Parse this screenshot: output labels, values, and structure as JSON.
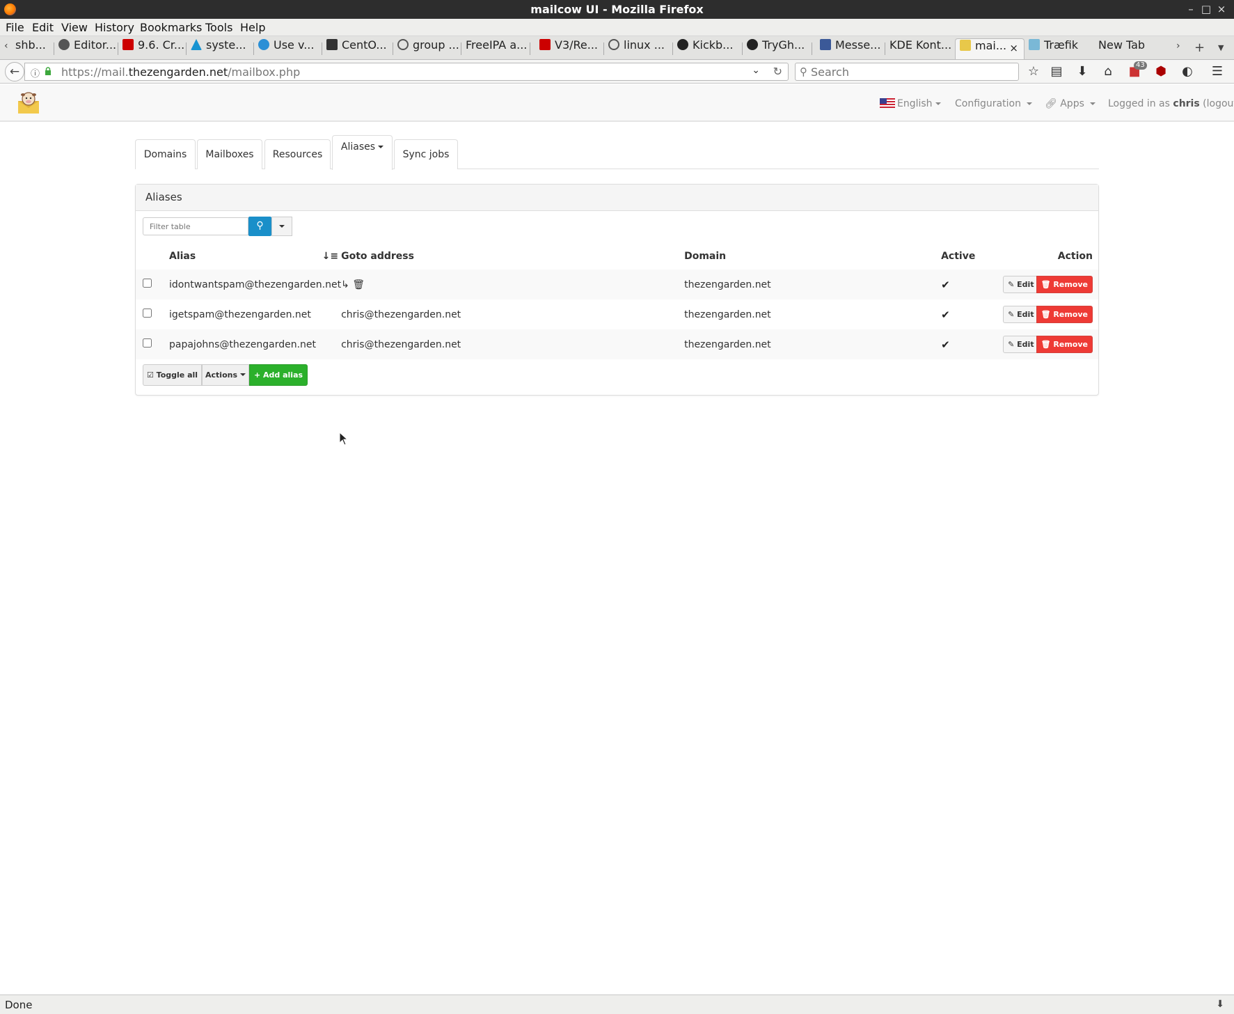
{
  "window": {
    "title": "mailcow UI - Mozilla Firefox",
    "minimize": "–",
    "maximize": "□",
    "close": "×"
  },
  "menu": [
    "File",
    "Edit",
    "View",
    "History",
    "Bookmarks",
    "Tools",
    "Help"
  ],
  "tabs": [
    {
      "label": "shb...",
      "icon": "page-icon"
    },
    {
      "label": "Editor...",
      "icon": "g-icon"
    },
    {
      "label": "9.6. Cr...",
      "icon": "redhat-icon"
    },
    {
      "label": "syste...",
      "icon": "arch-icon"
    },
    {
      "label": "Use v...",
      "icon": "globe-icon"
    },
    {
      "label": "CentO...",
      "icon": "book-icon"
    },
    {
      "label": "group ...",
      "icon": "google-icon"
    },
    {
      "label": "FreeIPA a...",
      "icon": "none"
    },
    {
      "label": "V3/Re...",
      "icon": "redhat-icon"
    },
    {
      "label": "linux ...",
      "icon": "google-icon"
    },
    {
      "label": "Kickb...",
      "icon": "github-icon"
    },
    {
      "label": "TryGh...",
      "icon": "github-icon"
    },
    {
      "label": "Messe...",
      "icon": "facebook-icon"
    },
    {
      "label": "KDE Kont...",
      "icon": "none"
    },
    {
      "label": "mai...",
      "icon": "mailcow-icon"
    },
    {
      "label": "Træfik",
      "icon": "traefik-icon"
    },
    {
      "label": "New Tab",
      "icon": "none"
    }
  ],
  "tab_close": "×",
  "address_bar": {
    "prefix": "https://mail.",
    "domain": "thezengarden.net",
    "path": "/mailbox.php"
  },
  "search": {
    "placeholder": "Search"
  },
  "toolbar_badge": "43",
  "app_header": {
    "language": "English",
    "configuration": "Configuration",
    "apps": "Apps",
    "logged_in_prefix": "Logged in as ",
    "user": "chris",
    "logout": "(logout)"
  },
  "page_tabs": {
    "domains": "Domains",
    "mailboxes": "Mailboxes",
    "resources": "Resources",
    "aliases": "Aliases",
    "sync_jobs": "Sync jobs"
  },
  "panel": {
    "heading": "Aliases",
    "filter_placeholder": "Filter table"
  },
  "table": {
    "headers": {
      "alias": "Alias",
      "goto": "Goto address",
      "domain": "Domain",
      "active": "Active",
      "action": "Action"
    },
    "rows": [
      {
        "alias": "idontwantspam@thezengarden.net",
        "goto": "",
        "goto_icons": "↳ 🗑",
        "domain": "thezengarden.net",
        "active": "✔"
      },
      {
        "alias": "igetspam@thezengarden.net",
        "goto": "chris@thezengarden.net",
        "goto_icons": "",
        "domain": "thezengarden.net",
        "active": "✔"
      },
      {
        "alias": "papajohns@thezengarden.net",
        "goto": "chris@thezengarden.net",
        "goto_icons": "",
        "domain": "thezengarden.net",
        "active": "✔"
      }
    ],
    "edit_label": "Edit",
    "remove_label": "Remove"
  },
  "footer_buttons": {
    "toggle_all": "Toggle all",
    "actions": "Actions",
    "add_alias": "Add alias"
  },
  "status": "Done",
  "colors": {
    "remove": "#ee3a35",
    "add": "#2bb02b",
    "search_button": "#1a8fc9"
  }
}
